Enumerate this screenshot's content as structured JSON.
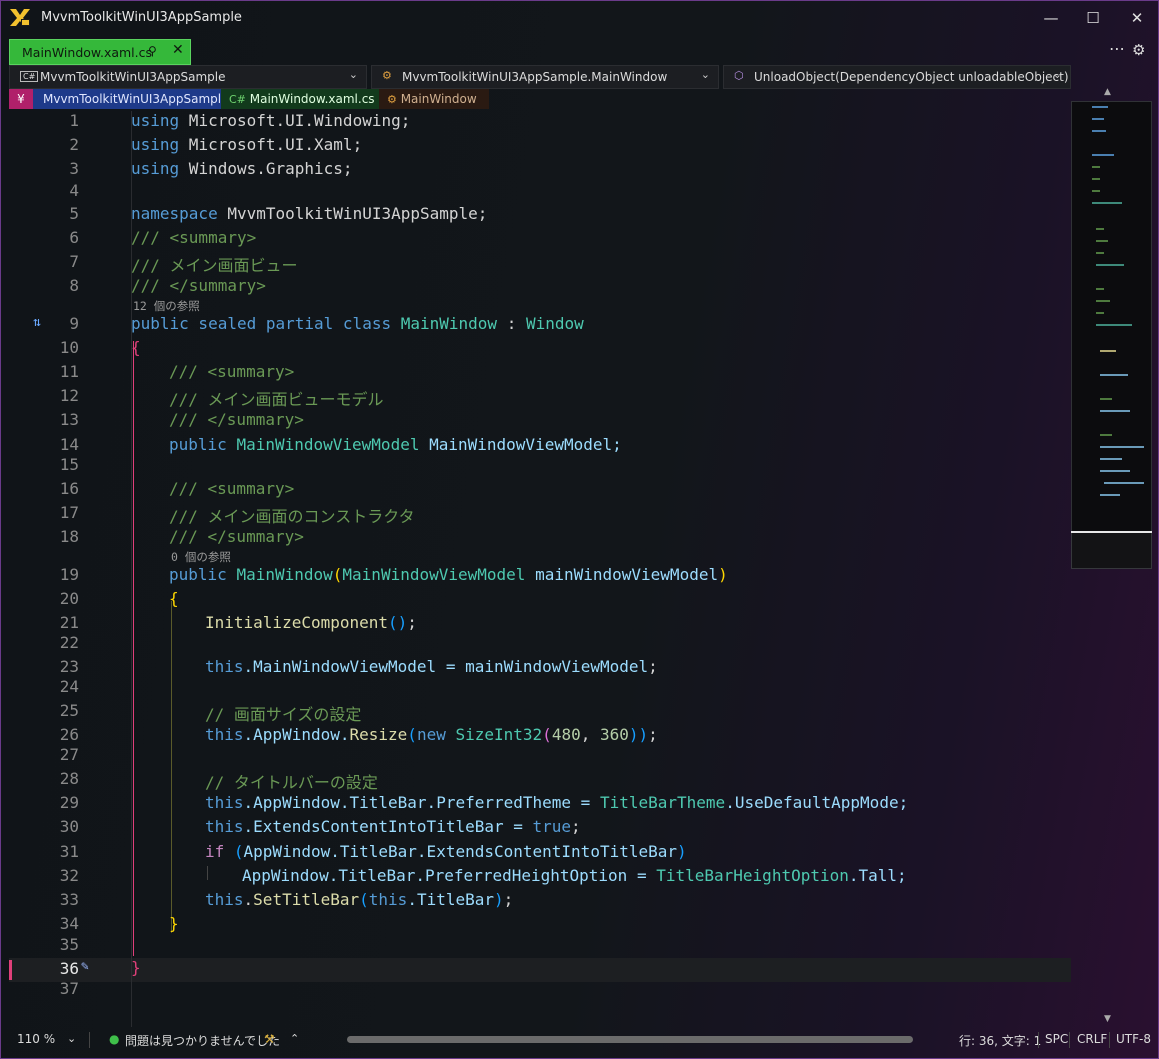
{
  "window": {
    "title": "MvvmToolkitWinUI3AppSample",
    "minimize": "—",
    "maximize": "☐",
    "close": "✕"
  },
  "tabs": [
    {
      "label": "MainWindow.xaml.cs",
      "pin": "⚲",
      "close": "✕"
    }
  ],
  "toolbar": {
    "more": "⋯",
    "settings": "⚙"
  },
  "nav": {
    "project": "MvvmToolkitWinUI3AppSample",
    "class": "MvvmToolkitWinUI3AppSample.MainWindow",
    "member": "UnloadObject(DependencyObject unloadableObject)"
  },
  "breadcrumb": {
    "project": "MvvmToolkitWinUI3AppSample",
    "file": "MainWindow.xaml.cs",
    "class": "MainWindow"
  },
  "codelens": {
    "class_refs": "12 個の参照",
    "ctor_refs": "0 個の参照"
  },
  "line_numbers": [
    "1",
    "2",
    "3",
    "4",
    "5",
    "6",
    "7",
    "8",
    "9",
    "10",
    "11",
    "12",
    "13",
    "14",
    "15",
    "16",
    "17",
    "18",
    "19",
    "20",
    "21",
    "22",
    "23",
    "24",
    "25",
    "26",
    "27",
    "28",
    "29",
    "30",
    "31",
    "32",
    "33",
    "34",
    "35",
    "36",
    "37"
  ],
  "code": {
    "l1": {
      "kw": "using",
      "rest": " Microsoft.UI.Windowing;"
    },
    "l2": {
      "kw": "using",
      "rest": " Microsoft.UI.Xaml;"
    },
    "l3": {
      "kw": "using",
      "rest": " Windows.Graphics;"
    },
    "l5": {
      "kw": "namespace",
      "rest": " MvvmToolkitWinUI3AppSample;"
    },
    "l6": "/// <summary>",
    "l7": "/// メイン画面ビュー",
    "l8": "/// </summary>",
    "l9": {
      "kw": "public sealed partial class",
      "name": "MainWindow",
      "colon": " : ",
      "base": "Window"
    },
    "l10": "{",
    "l11": "/// <summary>",
    "l12": "/// メイン画面ビューモデル",
    "l13": "/// </summary>",
    "l14": {
      "kw": "public",
      "type": "MainWindowViewModel",
      "name": " MainWindowViewModel;"
    },
    "l16": "/// <summary>",
    "l17": "/// メイン画面のコンストラクタ",
    "l18": "/// </summary>",
    "l19": {
      "kw": "public",
      "name": "MainWindow",
      "open": "(",
      "type": "MainWindowViewModel",
      "param": " mainWindowViewModel",
      "close": ")"
    },
    "l20": "{",
    "l21": {
      "fn": "InitializeComponent",
      "paren": "()",
      "semi": ";"
    },
    "l23": {
      "kw": "this",
      "rest": ".MainWindowViewModel = ",
      "var": "mainWindowViewModel",
      "semi": ";"
    },
    "l25": "// 画面サイズの設定",
    "l26": {
      "kw": "this",
      "a": ".AppWindow.",
      "fn": "Resize",
      "open": "(",
      "new": "new",
      "type": " SizeInt32",
      "p2": "(",
      "n1": "480",
      "comma": ", ",
      "n2": "360",
      "p3": "))",
      "semi": ";"
    },
    "l28": "// タイトルバーの設定",
    "l29": {
      "kw": "this",
      "a": ".AppWindow.TitleBar.PreferredTheme = ",
      "type": "TitleBarTheme",
      "b": ".UseDefaultAppMode;"
    },
    "l30": {
      "kw": "this",
      "a": ".ExtendsContentIntoTitleBar = ",
      "val": "true",
      "semi": ";"
    },
    "l31": {
      "kw": "if",
      "open": " (",
      "a": "AppWindow.TitleBar.ExtendsContentIntoTitleBar",
      "close": ")"
    },
    "l32": {
      "a": "AppWindow.TitleBar.PreferredHeightOption = ",
      "type": "TitleBarHeightOption",
      "b": ".Tall;"
    },
    "l33": {
      "kw": "this",
      "a": ".",
      "fn": "SetTitleBar",
      "open": "(",
      "kw2": "this",
      "b": ".TitleBar",
      "close": ")",
      "semi": ";"
    },
    "l34": "}",
    "l36": "}"
  },
  "status": {
    "zoom": "110 %",
    "issues": "問題は見つかりませんでした",
    "position": "行: 36, 文字: 1",
    "whitespace": "SPC",
    "line_ending": "CRLF",
    "encoding": "UTF-8"
  },
  "colors": {
    "tab_accent": "#35b83a",
    "breadcrumb_accent": "#b0206a",
    "keyword": "#569cd6",
    "comment": "#6a9955",
    "type": "#4ec9b0"
  }
}
